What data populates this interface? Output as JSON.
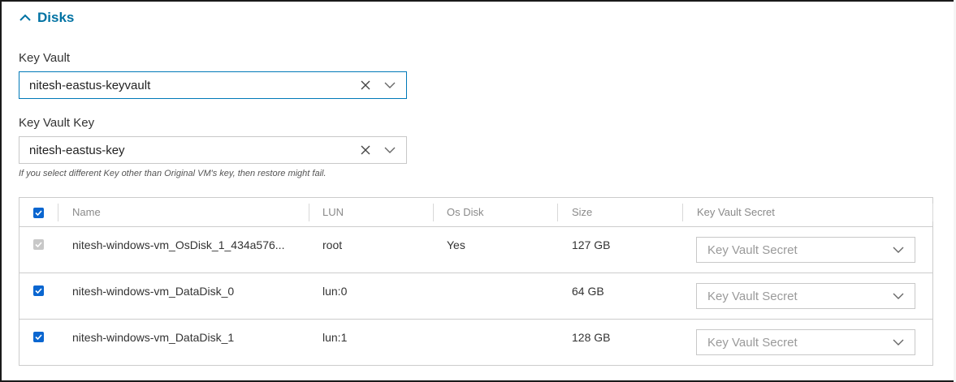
{
  "section": {
    "title": "Disks",
    "expanded": true
  },
  "key_vault": {
    "label": "Key Vault",
    "value": "nitesh-eastus-keyvault"
  },
  "key_vault_key": {
    "label": "Key Vault Key",
    "value": "nitesh-eastus-key",
    "hint": "If you select different Key other than Original VM's key, then restore might fail."
  },
  "table": {
    "header_checked": true,
    "columns": [
      "Name",
      "LUN",
      "Os Disk",
      "Size",
      "Key Vault Secret"
    ],
    "rows": [
      {
        "checked": true,
        "disabled": true,
        "name": "nitesh-windows-vm_OsDisk_1_434a576...",
        "lun": "root",
        "os_disk": "Yes",
        "size": "127 GB",
        "secret_placeholder": "Key Vault Secret"
      },
      {
        "checked": true,
        "disabled": false,
        "name": "nitesh-windows-vm_DataDisk_0",
        "lun": "lun:0",
        "os_disk": "",
        "size": "64 GB",
        "secret_placeholder": "Key Vault Secret"
      },
      {
        "checked": true,
        "disabled": false,
        "name": "nitesh-windows-vm_DataDisk_1",
        "lun": "lun:1",
        "os_disk": "",
        "size": "128 GB",
        "secret_placeholder": "Key Vault Secret"
      }
    ]
  },
  "colors": {
    "accent": "#0072a3",
    "checkbox": "#0a66d0",
    "checkbox_disabled": "#c8c8c8",
    "border": "#cccccc",
    "focus_border": "#0079b8"
  },
  "icons": {
    "section_toggle": "chevron-up-icon",
    "clear": "close-icon",
    "dropdown": "chevron-down-icon",
    "check": "check-icon"
  }
}
